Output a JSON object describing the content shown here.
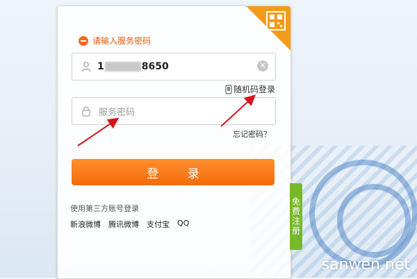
{
  "error": {
    "text": "请输入服务密码"
  },
  "account": {
    "value_prefix": "1",
    "value_suffix": "8650"
  },
  "password": {
    "placeholder": "服务密码"
  },
  "links": {
    "random_code_login": "随机码登录",
    "forgot_password": "忘记密码？"
  },
  "login_button": {
    "label": "登 录"
  },
  "third_party": {
    "label": "使用第三方账号登录",
    "providers": [
      "新浪微博",
      "腾讯微博",
      "支付宝",
      "QQ"
    ]
  },
  "register_tab": {
    "label": "免费注册"
  },
  "watermark": {
    "text": "sanwen.net"
  },
  "colors": {
    "accent": "#f36b0a",
    "error": "#e15a10",
    "register": "#77b82b",
    "arrow": "#d4141b"
  },
  "icons": {
    "error": "minus-circle-icon",
    "user": "user-icon",
    "lock": "lock-icon",
    "clear": "clear-icon",
    "phone": "phone-icon",
    "qr": "qr-code-icon"
  }
}
